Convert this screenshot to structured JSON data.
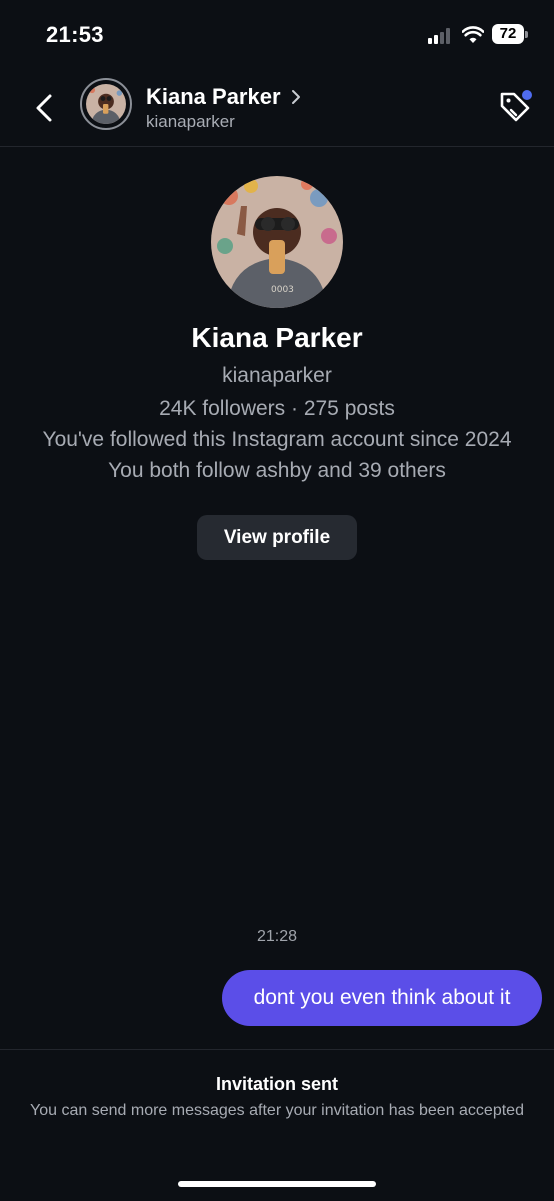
{
  "status_bar": {
    "time": "21:53",
    "battery": "72"
  },
  "header": {
    "name": "Kiana Parker",
    "username": "kianaparker"
  },
  "profile": {
    "name": "Kiana Parker",
    "username": "kianaparker",
    "stats": "24K followers · 275 posts",
    "followed_since": "You've followed this Instagram account since 2024",
    "mutual": "You both follow ashby and 39 others",
    "view_profile_label": "View profile"
  },
  "messages": [
    {
      "timestamp": "21:28",
      "text": "dont you even think about it",
      "from": "me"
    }
  ],
  "footer": {
    "title": "Invitation sent",
    "text": "You can send more messages after your invitation has been accepted"
  },
  "colors": {
    "background": "#0c0f14",
    "bubble": "#5b4ee8",
    "notification_dot": "#4f6cf0",
    "muted_text": "#a7abb3"
  }
}
